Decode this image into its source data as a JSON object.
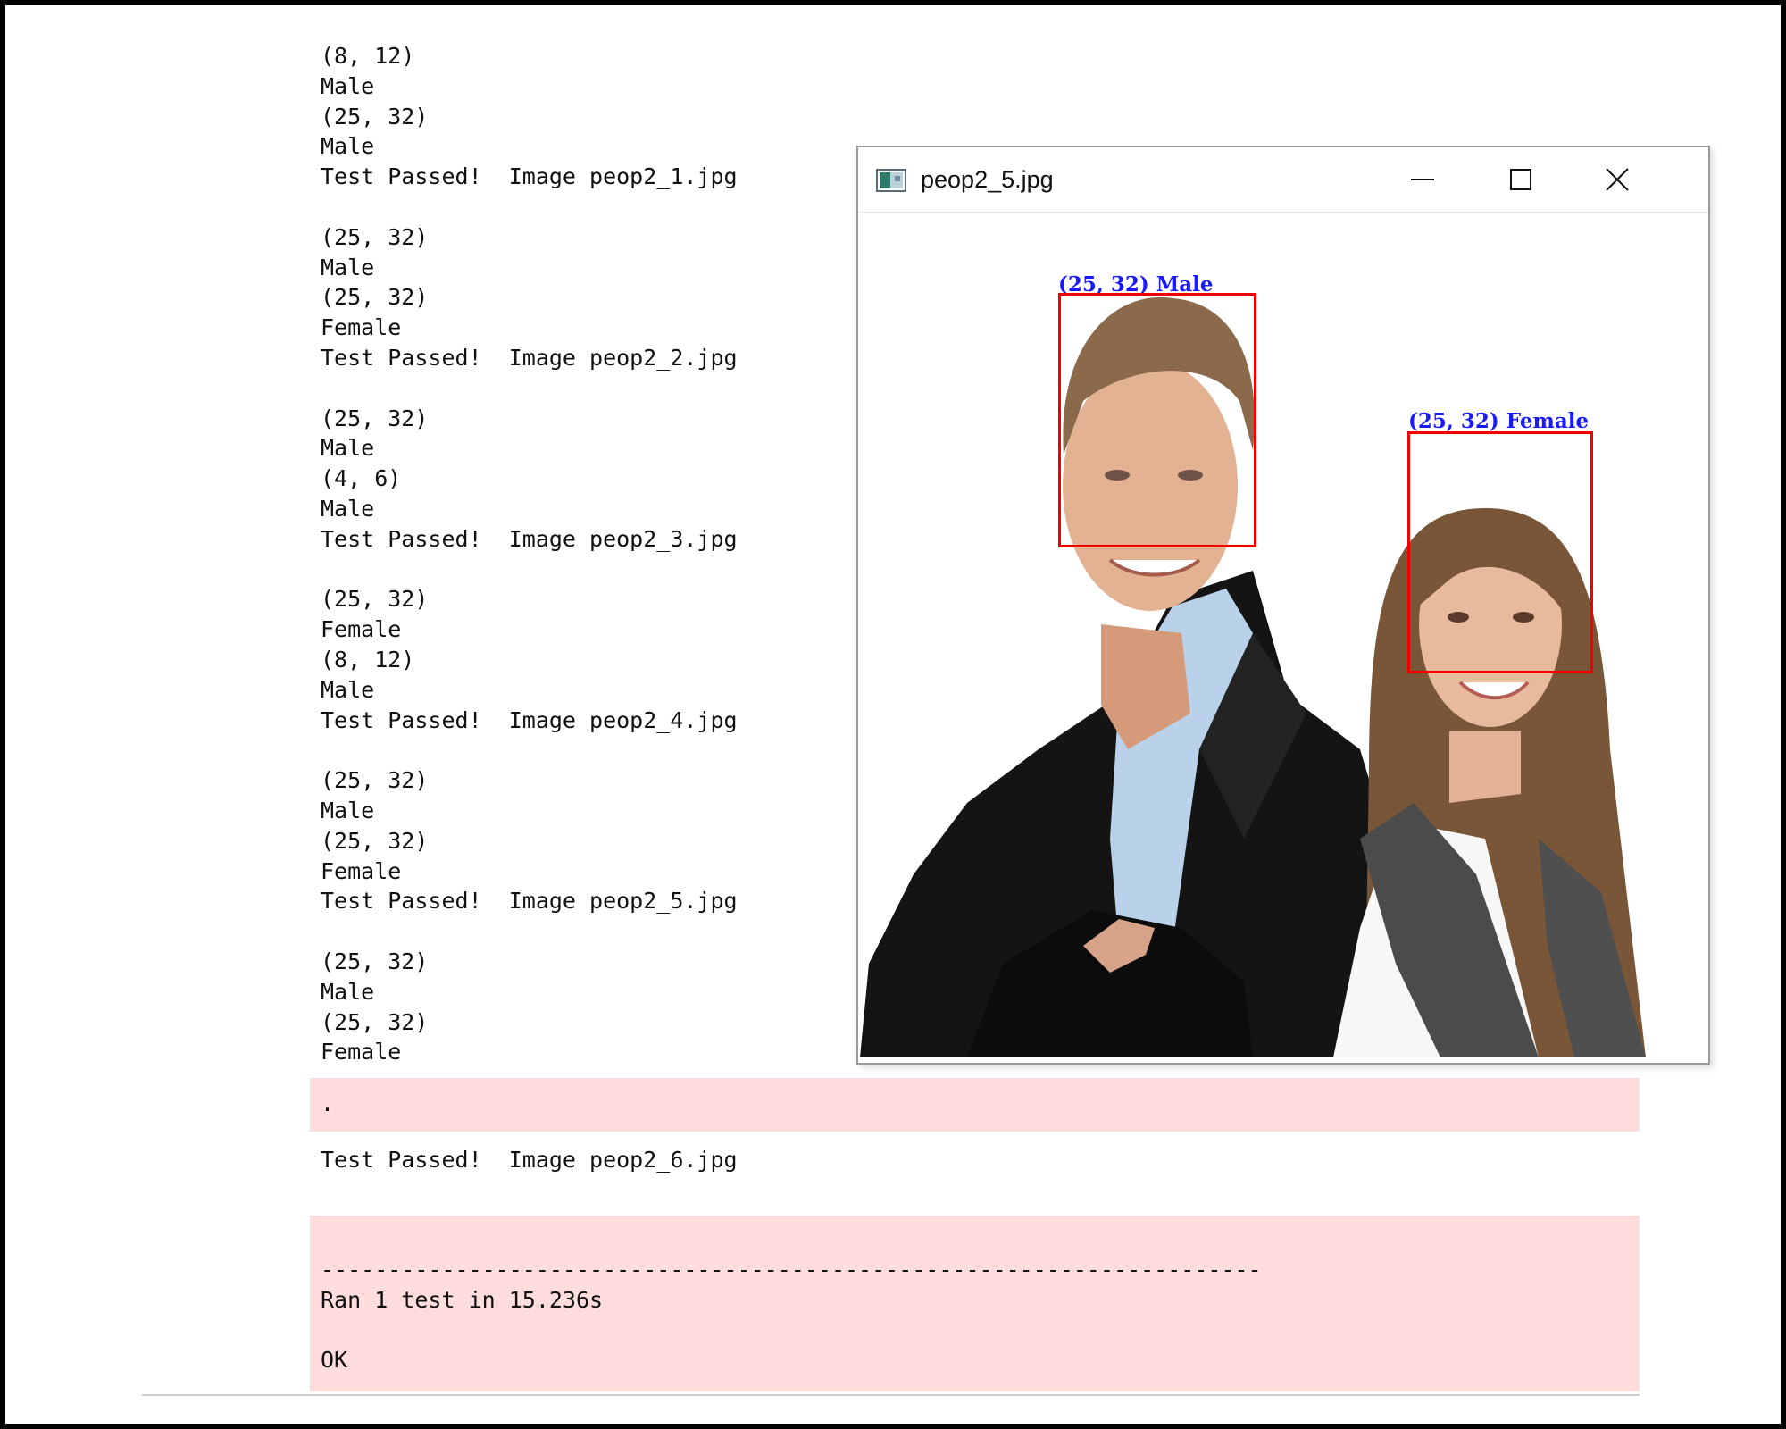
{
  "console": {
    "lines": [
      "(8, 12)",
      "Male",
      "(25, 32)",
      "Male",
      "Test Passed!  Image peop2_1.jpg",
      "",
      "(25, 32)",
      "Male",
      "(25, 32)",
      "Female",
      "Test Passed!  Image peop2_2.jpg",
      "",
      "(25, 32)",
      "Male",
      "(4, 6)",
      "Male",
      "Test Passed!  Image peop2_3.jpg",
      "",
      "(25, 32)",
      "Female",
      "(8, 12)",
      "Male",
      "Test Passed!  Image peop2_4.jpg",
      "",
      "(25, 32)",
      "Male",
      "(25, 32)",
      "Female",
      "Test Passed!  Image peop2_5.jpg",
      "",
      "(25, 32)",
      "Male",
      "(25, 32)",
      "Female"
    ],
    "stderr_dot": ".",
    "final_pass": "Test Passed!  Image peop2_6.jpg",
    "separator": "----------------------------------------------------------------------",
    "summary": "Ran 1 test in 15.236s",
    "status": "OK"
  },
  "image_window": {
    "title": "peop2_5.jpg",
    "detections": [
      {
        "label": "(25, 32) Male"
      },
      {
        "label": "(25, 32) Female"
      }
    ]
  },
  "colors": {
    "stderr_background": "#ffdddd",
    "box_color": "#f20000",
    "label_color": "#1a1aff"
  }
}
